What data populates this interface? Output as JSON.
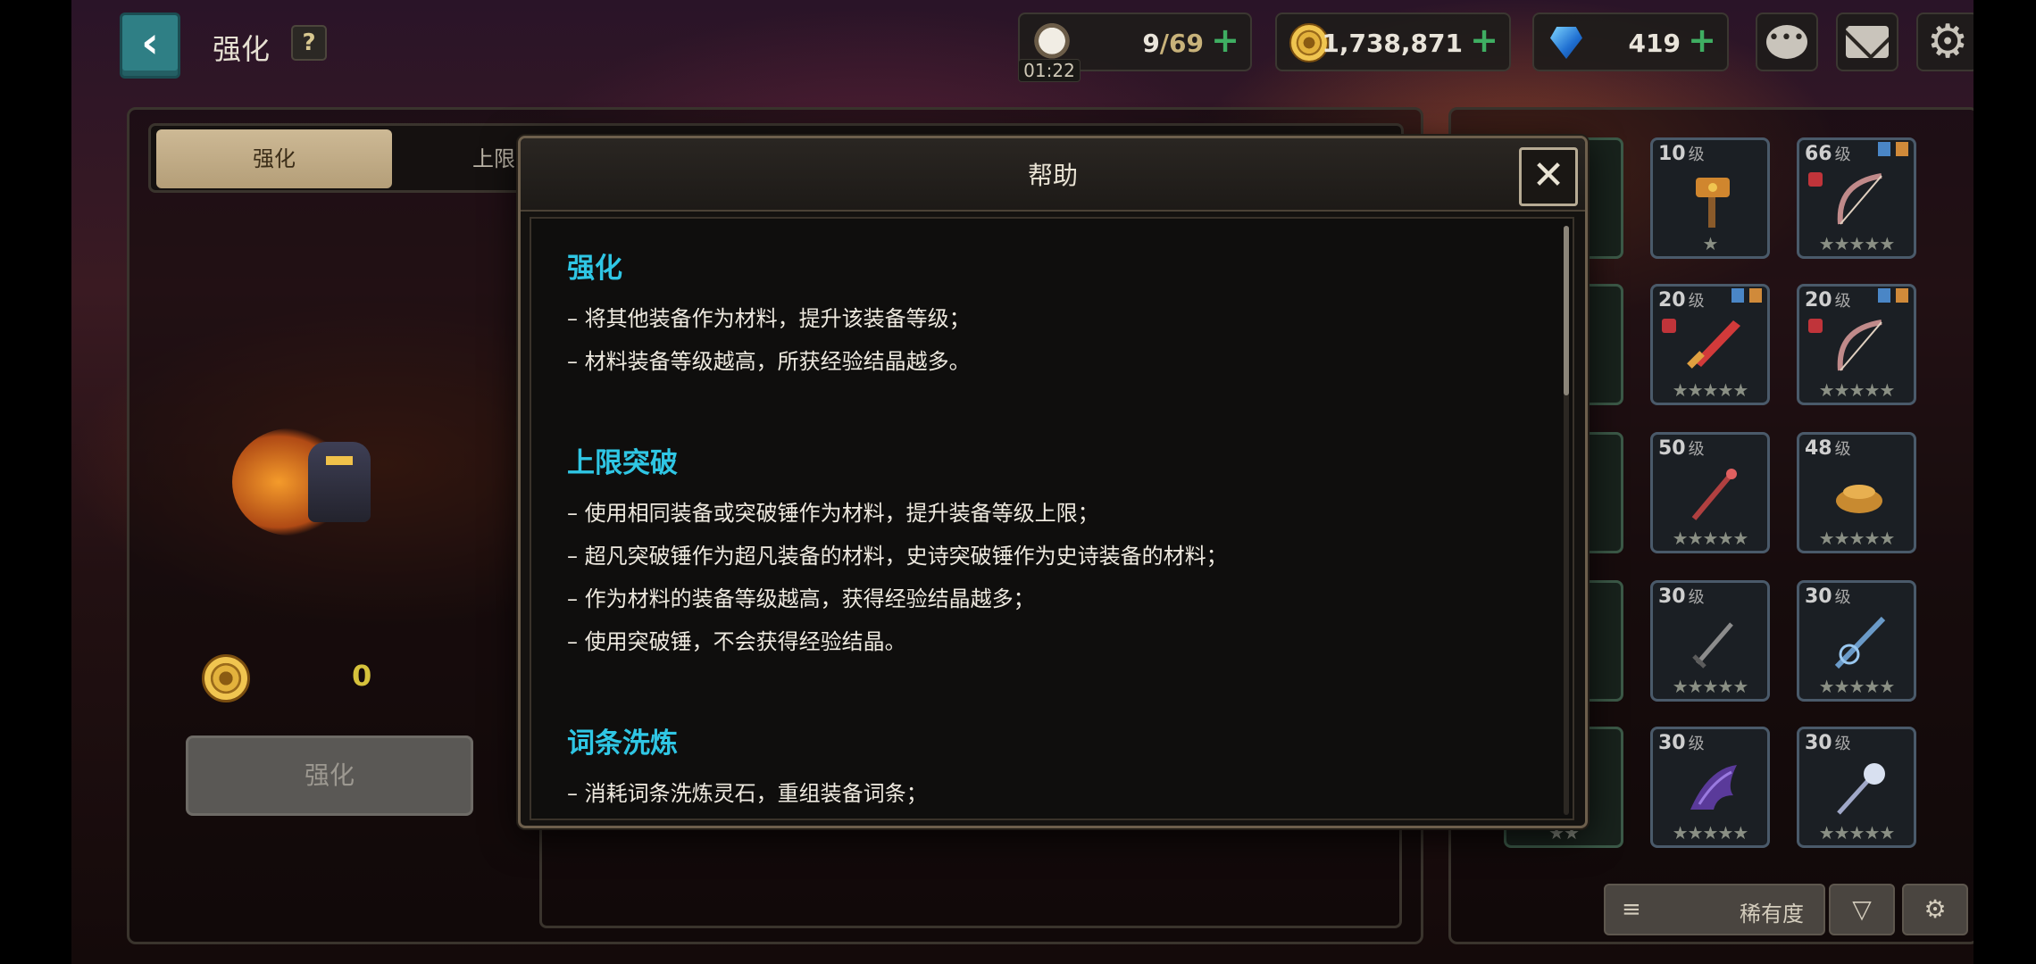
{
  "header": {
    "title": "强化",
    "help_label": "?",
    "back_label": "‹"
  },
  "resources": {
    "stamina": {
      "current": "9",
      "max": "/69",
      "timer": "01:22",
      "icon": "coffee-cup-icon"
    },
    "gold": {
      "value": "1,738,871",
      "icon": "gold-coin-icon"
    },
    "gems": {
      "value": "419",
      "icon": "blue-gem-icon"
    },
    "plus_label": "+"
  },
  "tabs": [
    {
      "label": "强化",
      "active": true
    },
    {
      "label": "上限",
      "active": false
    }
  ],
  "enhance": {
    "cost_value": "0",
    "button_label": "强化"
  },
  "inventory": {
    "slots": [
      {
        "level": "10",
        "unit": "级",
        "stars": "★",
        "item": "hammer"
      },
      {
        "level": "66",
        "unit": "级",
        "stars": "★★★★★",
        "item": "bow",
        "locked": true
      },
      {
        "level": "20",
        "unit": "级",
        "stars": "★★★★★",
        "item": "sword",
        "locked": true
      },
      {
        "level": "20",
        "unit": "级",
        "stars": "★★★★★",
        "item": "bow",
        "locked": true
      },
      {
        "level": "50",
        "unit": "级",
        "stars": "★★★★★",
        "item": "staff"
      },
      {
        "level": "48",
        "unit": "级",
        "stars": "★★★★★",
        "item": "basket"
      },
      {
        "level": "30",
        "unit": "级",
        "stars": "★★★★★",
        "item": "dagger"
      },
      {
        "level": "30",
        "unit": "级",
        "stars": "★★★★★",
        "item": "spear"
      },
      {
        "level": "30",
        "unit": "级",
        "stars": "★★★★★",
        "item": "wing"
      },
      {
        "level": "30",
        "unit": "级",
        "stars": "★★★★★",
        "item": "wand"
      }
    ],
    "partial_stars": "★★",
    "sort_label": "稀有度",
    "sort_icon": "≡",
    "filter_icon": "▽",
    "settings_icon": "⚙"
  },
  "modal": {
    "title": "帮助",
    "close_label": "✕",
    "sections": [
      {
        "title": "强化",
        "lines": [
          "– 将其他装备作为材料，提升该装备等级；",
          "– 材料装备等级越高，所获经验结晶越多。"
        ]
      },
      {
        "title": "上限突破",
        "lines": [
          "– 使用相同装备或突破锤作为材料，提升装备等级上限；",
          "– 超凡突破锤作为超凡装备的材料，史诗突破锤作为史诗装备的材料；",
          "– 作为材料的装备等级越高，获得经验结晶越多；",
          "– 使用突破锤，不会获得经验结晶。"
        ]
      },
      {
        "title": "词条洗炼",
        "lines": [
          "– 消耗词条洗炼灵石，重组装备词条；"
        ]
      }
    ]
  },
  "colors": {
    "section_title": "#2fc6e4",
    "back_button": "#2f7f85",
    "plus": "#3fae62"
  }
}
